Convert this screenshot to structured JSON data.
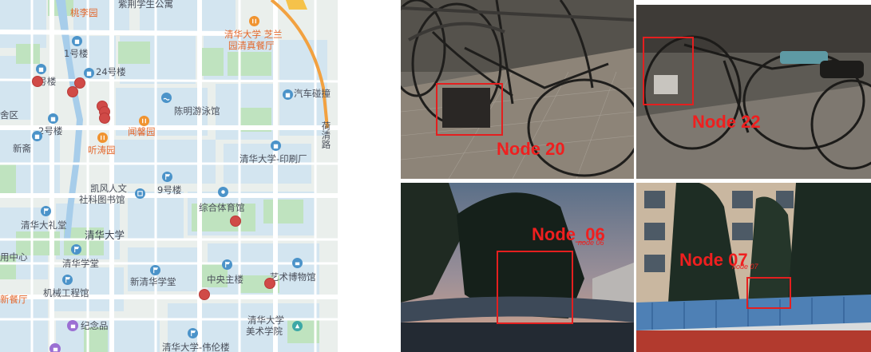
{
  "map": {
    "labels": {
      "taoliyuan": "桃李园",
      "zijing": "紫荆学生公寓",
      "zhilan": "清华大学 芝兰",
      "zhilan2": "园清真餐厅",
      "no1": "1号楼",
      "no24": "24号楼",
      "no2_top": "2号楼",
      "qiche": "汽车碰撞",
      "he_qing_lu": "荷清路",
      "xiqu": "舍区",
      "no2": "2号楼",
      "xinzhai": "新斋",
      "tingtao": "听涛园",
      "wenxin": "闻馨园",
      "chenming": "陈明游泳馆",
      "yinshua": "清华大学-印刷厂",
      "kaifeng1": "凯风人文",
      "kaifeng2": "社科图书馆",
      "no9": "9号楼",
      "zonghe": "综合体育馆",
      "dalitang": "清华大礼堂",
      "qinghua": "清华大学",
      "zhongxin": "用中心",
      "xuetang": "清华学堂",
      "xinxuetang": "新清华学堂",
      "zhongyang": "中央主楼",
      "yishu": "艺术博物馆",
      "xincanting": "新餐厅",
      "jixie": "机械工程馆",
      "jinianpin": "纪念品",
      "meishu1": "清华大学",
      "meishu2": "美术学院",
      "weilun": "清华大学-伟伦楼"
    }
  },
  "photos": {
    "node20": "Node 20",
    "node22": "Node 22",
    "node06": "Node_06",
    "node06_ghost": "node 06",
    "node07": "Node 07",
    "node07_ghost": "node 07"
  },
  "colors": {
    "node_marker": "#d04a47",
    "bbox": "#e41f1f",
    "map_road": "#ffffff",
    "map_block": "#d3e5f0",
    "map_green": "#bfe3bf",
    "map_water": "#a7cdea"
  }
}
